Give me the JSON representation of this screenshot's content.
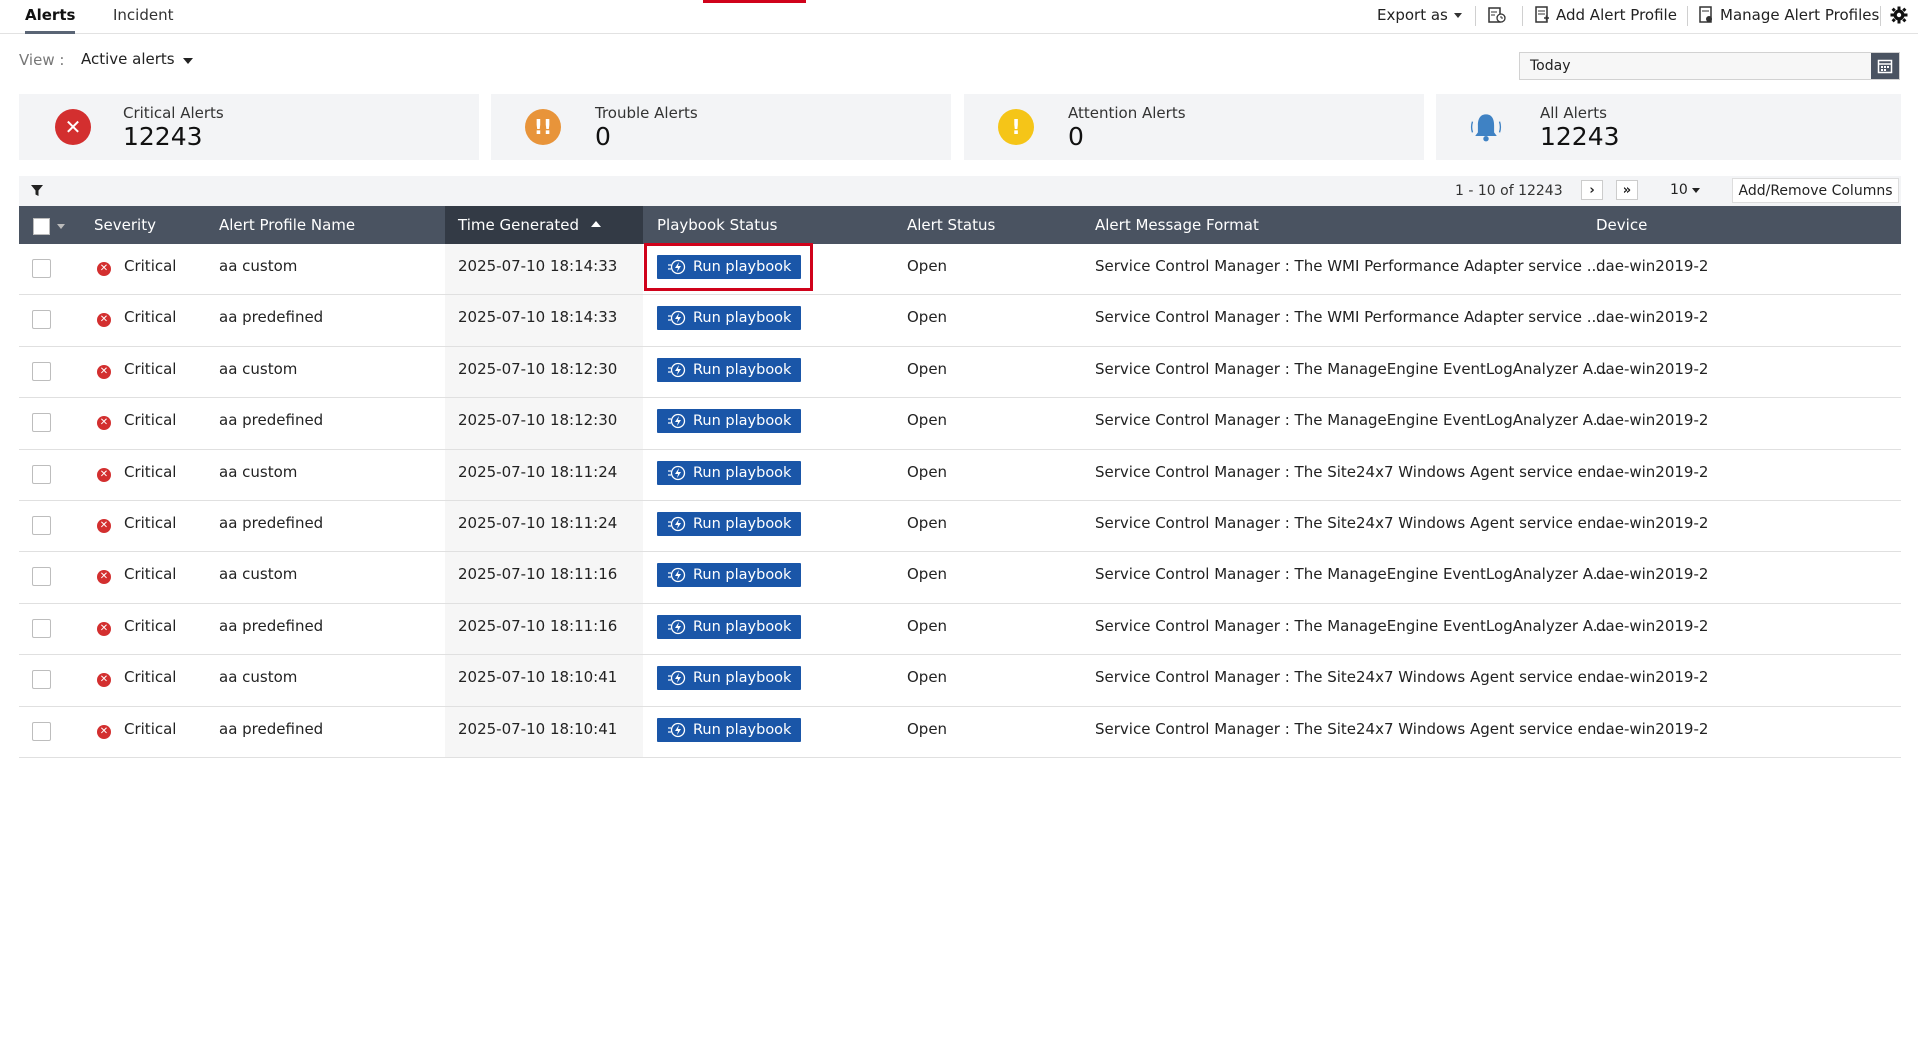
{
  "tabs": [
    {
      "label": "Alerts",
      "active": true
    },
    {
      "label": "Incident",
      "active": false
    }
  ],
  "toolbar": {
    "export_label": "Export as",
    "add_profile_label": "Add Alert Profile",
    "manage_profiles_label": "Manage Alert Profiles"
  },
  "view": {
    "label": "View :",
    "value": "Active alerts"
  },
  "date_filter": {
    "value": "Today"
  },
  "summary": [
    {
      "label": "Critical Alerts",
      "count": "12243",
      "color": "#d32f2f",
      "icon": "x-circle-icon"
    },
    {
      "label": "Trouble Alerts",
      "count": "0",
      "color": "#e8943a",
      "icon": "double-exclamation-icon"
    },
    {
      "label": "Attention Alerts",
      "count": "0",
      "color": "#f5c518",
      "icon": "exclamation-icon"
    },
    {
      "label": "All Alerts",
      "count": "12243",
      "color": "#3f82c4",
      "icon": "bell-icon"
    }
  ],
  "pager": {
    "range_text": "1 - 10 of 12243",
    "page_size": "10",
    "add_remove_columns": "Add/Remove Columns"
  },
  "columns": [
    "Severity",
    "Alert Profile Name",
    "Time Generated",
    "Playbook Status",
    "Alert Status",
    "Alert Message Format",
    "Device"
  ],
  "rows": [
    {
      "severity": "Critical",
      "profile": "aa custom",
      "time": "2025-07-10 18:14:33",
      "playbook": "Run playbook",
      "status": "Open",
      "message": "Service Control Manager : The WMI Performance Adapter service ...",
      "device": "dae-win2019-2"
    },
    {
      "severity": "Critical",
      "profile": "aa predefined",
      "time": "2025-07-10 18:14:33",
      "playbook": "Run playbook",
      "status": "Open",
      "message": "Service Control Manager : The WMI Performance Adapter service ...",
      "device": "dae-win2019-2"
    },
    {
      "severity": "Critical",
      "profile": "aa custom",
      "time": "2025-07-10 18:12:30",
      "playbook": "Run playbook",
      "status": "Open",
      "message": "Service Control Manager : The ManageEngine EventLogAnalyzer A...",
      "device": "dae-win2019-2"
    },
    {
      "severity": "Critical",
      "profile": "aa predefined",
      "time": "2025-07-10 18:12:30",
      "playbook": "Run playbook",
      "status": "Open",
      "message": "Service Control Manager : The ManageEngine EventLogAnalyzer A...",
      "device": "dae-win2019-2"
    },
    {
      "severity": "Critical",
      "profile": "aa custom",
      "time": "2025-07-10 18:11:24",
      "playbook": "Run playbook",
      "status": "Open",
      "message": "Service Control Manager : The Site24x7 Windows Agent service en...",
      "device": "dae-win2019-2"
    },
    {
      "severity": "Critical",
      "profile": "aa predefined",
      "time": "2025-07-10 18:11:24",
      "playbook": "Run playbook",
      "status": "Open",
      "message": "Service Control Manager : The Site24x7 Windows Agent service en...",
      "device": "dae-win2019-2"
    },
    {
      "severity": "Critical",
      "profile": "aa custom",
      "time": "2025-07-10 18:11:16",
      "playbook": "Run playbook",
      "status": "Open",
      "message": "Service Control Manager : The ManageEngine EventLogAnalyzer A...",
      "device": "dae-win2019-2"
    },
    {
      "severity": "Critical",
      "profile": "aa predefined",
      "time": "2025-07-10 18:11:16",
      "playbook": "Run playbook",
      "status": "Open",
      "message": "Service Control Manager : The ManageEngine EventLogAnalyzer A...",
      "device": "dae-win2019-2"
    },
    {
      "severity": "Critical",
      "profile": "aa custom",
      "time": "2025-07-10 18:10:41",
      "playbook": "Run playbook",
      "status": "Open",
      "message": "Service Control Manager : The Site24x7 Windows Agent service en...",
      "device": "dae-win2019-2"
    },
    {
      "severity": "Critical",
      "profile": "aa predefined",
      "time": "2025-07-10 18:10:41",
      "playbook": "Run playbook",
      "status": "Open",
      "message": "Service Control Manager : The Site24x7 Windows Agent service en...",
      "device": "dae-win2019-2"
    }
  ]
}
